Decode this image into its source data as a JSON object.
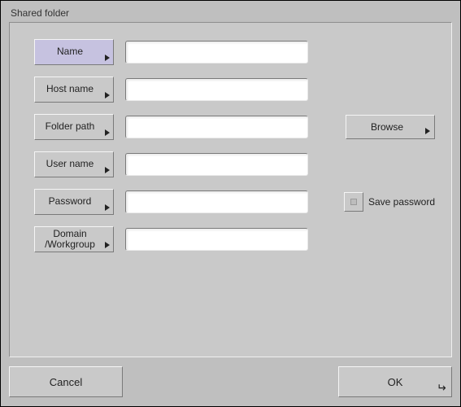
{
  "title": "Shared folder",
  "fields": {
    "name": {
      "label": "Name",
      "value": ""
    },
    "host_name": {
      "label": "Host name",
      "value": ""
    },
    "folder_path": {
      "label": "Folder path",
      "value": ""
    },
    "user_name": {
      "label": "User name",
      "value": ""
    },
    "password": {
      "label": "Password",
      "value": ""
    },
    "domain": {
      "label": "Domain\n/Workgroup",
      "value": ""
    }
  },
  "browse_label": "Browse",
  "save_password": {
    "label": "Save password",
    "checked": false
  },
  "buttons": {
    "cancel": "Cancel",
    "ok": "OK"
  }
}
